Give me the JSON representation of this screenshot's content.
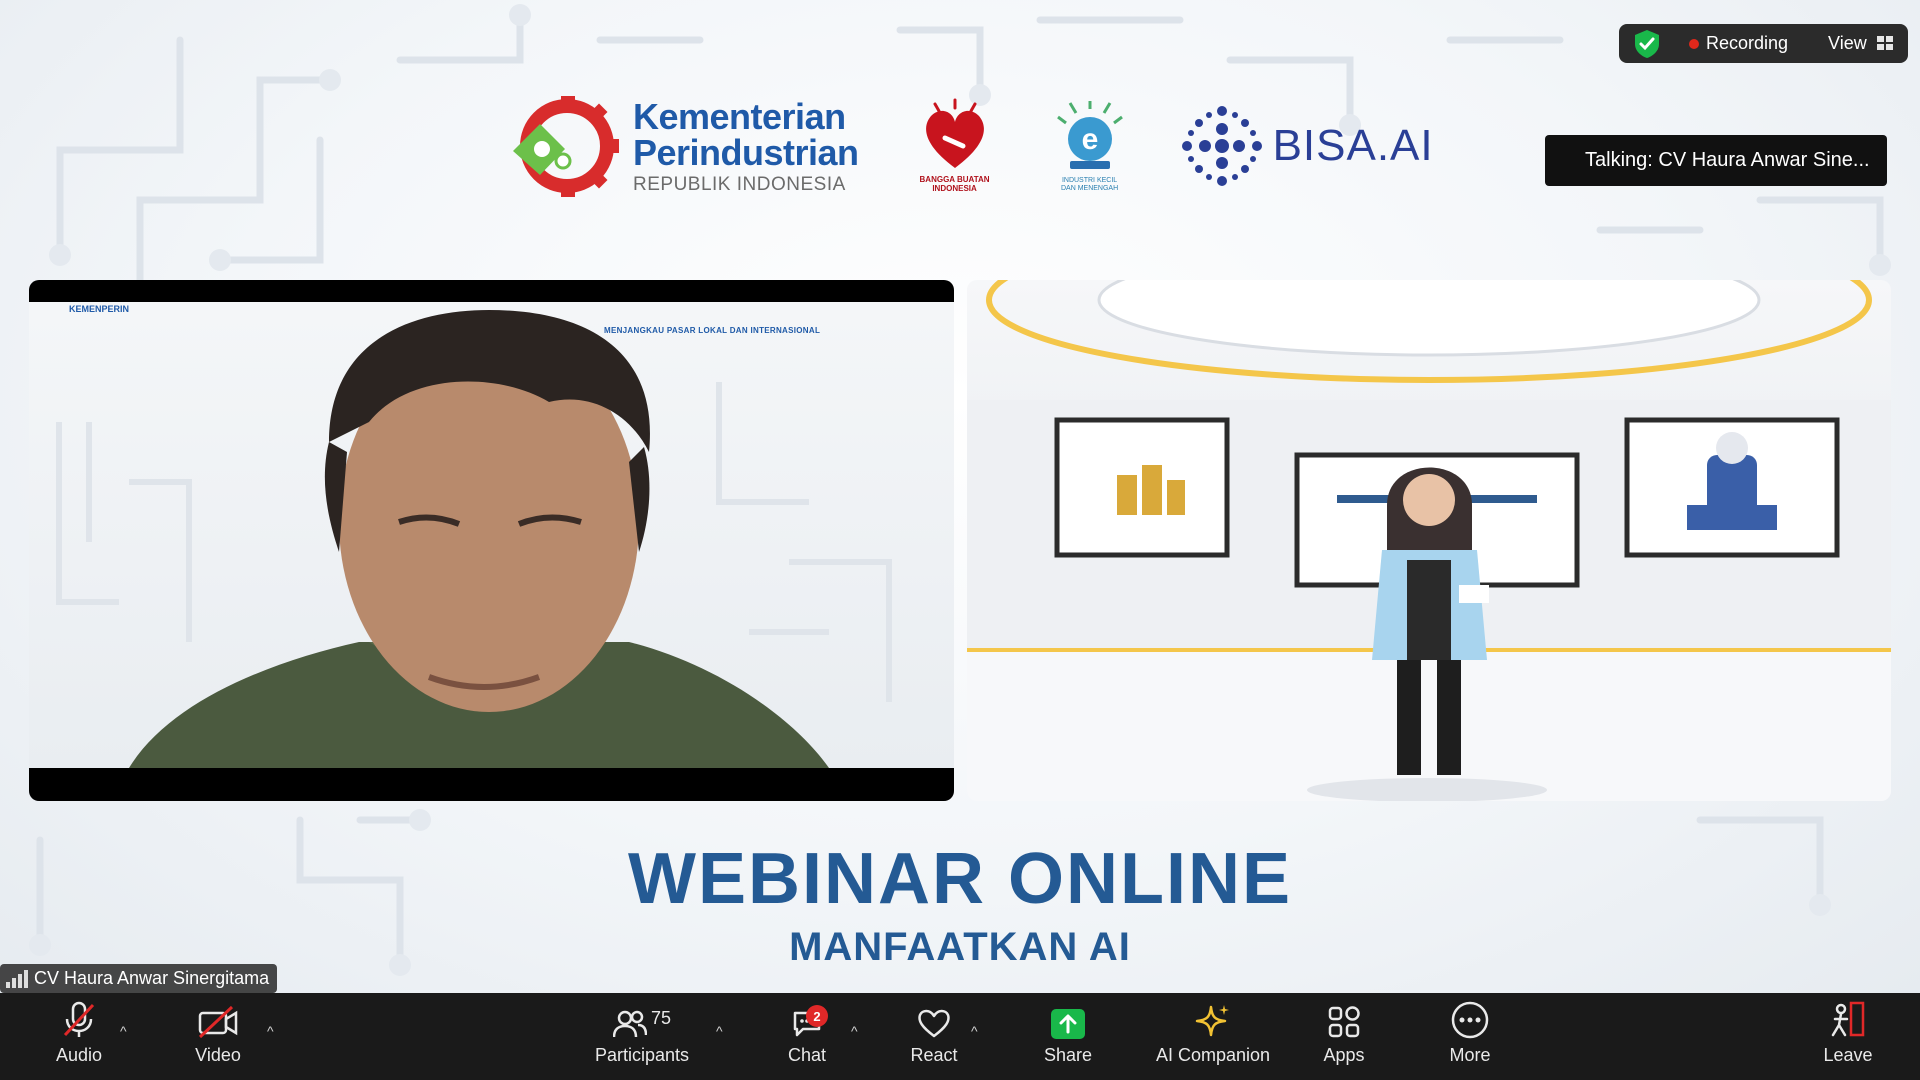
{
  "recording": {
    "label": "Recording",
    "view_label": "View"
  },
  "talking": {
    "text": "Talking: CV Haura Anwar Sine..."
  },
  "name_tag": {
    "text": "CV Haura Anwar Sinergitama"
  },
  "logos": {
    "kemenperin": {
      "line1": "Kementerian",
      "line2": "Perindustrian",
      "line3": "REPUBLIK INDONESIA"
    },
    "bisa": "BISA.AI"
  },
  "webinar": {
    "title": "WEBINAR ONLINE",
    "subtitle": "MANFAATKAN AI"
  },
  "toolbar": {
    "audio": "Audio",
    "video": "Video",
    "participants": "Participants",
    "participants_count": "75",
    "chat": "Chat",
    "chat_badge": "2",
    "react": "React",
    "share": "Share",
    "ai_companion": "AI Companion",
    "apps": "Apps",
    "more": "More",
    "leave": "Leave"
  },
  "colors": {
    "accent_green": "#19b84a",
    "record_red": "#e0281b",
    "title_blue": "#245a94",
    "leave_red": "#e02828"
  }
}
